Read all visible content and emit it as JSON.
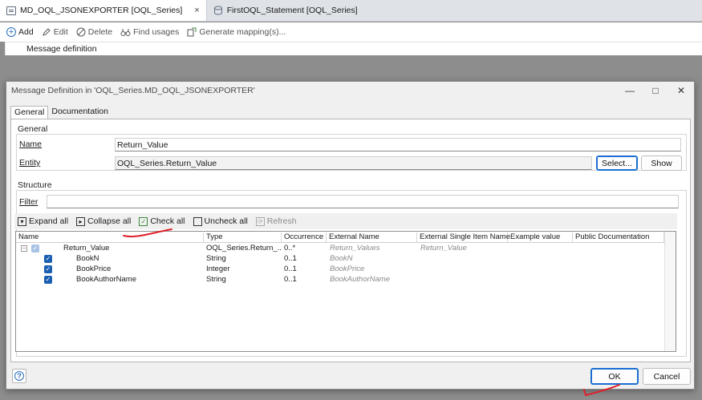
{
  "editor": {
    "tabs": [
      {
        "label": "MD_OQL_JSONEXPORTER [OQL_Series]",
        "close": "×"
      },
      {
        "label": "FirstOQL_Statement [OQL_Series]"
      }
    ],
    "toolbar": {
      "add": "Add",
      "edit": "Edit",
      "delete": "Delete",
      "find_usages": "Find usages",
      "generate_mapping": "Generate mapping(s)..."
    },
    "column_header": "Message definition"
  },
  "dialog": {
    "title": "Message Definition in 'OQL_Series.MD_OQL_JSONEXPORTER'",
    "window_buttons": {
      "minimize": "—",
      "maximize": "□",
      "close": "✕"
    },
    "tabs": {
      "general": "General",
      "documentation": "Documentation"
    },
    "general_group": {
      "label": "General",
      "name_label": "Name",
      "name_value": "Return_Value",
      "entity_label": "Entity",
      "entity_value": "OQL_Series.Return_Value",
      "select_button": "Select...",
      "show_button": "Show"
    },
    "structure_group": {
      "label": "Structure",
      "filter_label": "Filter",
      "filter_value": "",
      "toolbar": {
        "expand_all": "Expand all",
        "collapse_all": "Collapse all",
        "check_all": "Check all",
        "uncheck_all": "Uncheck all",
        "refresh": "Refresh"
      },
      "columns": [
        "Name",
        "Type",
        "Occurrence",
        "External Name",
        "External Single Item Name",
        "Example value",
        "Public Documentation"
      ],
      "rows": [
        {
          "name": "Return_Value",
          "type": "OQL_Series.Return_...",
          "occurrence": "0..*",
          "external_name": "Return_Values",
          "external_single_item_name": "Return_Value",
          "example_value": "",
          "public_documentation": "",
          "checked": true,
          "root": true
        },
        {
          "name": "BookN",
          "type": "String",
          "occurrence": "0..1",
          "external_name": "BookN",
          "external_single_item_name": "",
          "example_value": "",
          "public_documentation": "",
          "checked": true,
          "root": false
        },
        {
          "name": "BookPrice",
          "type": "Integer",
          "occurrence": "0..1",
          "external_name": "BookPrice",
          "external_single_item_name": "",
          "example_value": "",
          "public_documentation": "",
          "checked": true,
          "root": false
        },
        {
          "name": "BookAuthorName",
          "type": "String",
          "occurrence": "0..1",
          "external_name": "BookAuthorName",
          "external_single_item_name": "",
          "example_value": "",
          "public_documentation": "",
          "checked": true,
          "root": false
        }
      ]
    },
    "footer": {
      "help": "?",
      "ok": "OK",
      "cancel": "Cancel"
    }
  },
  "colors": {
    "accent": "#1b5fb1",
    "annotation": "#e0202a"
  }
}
